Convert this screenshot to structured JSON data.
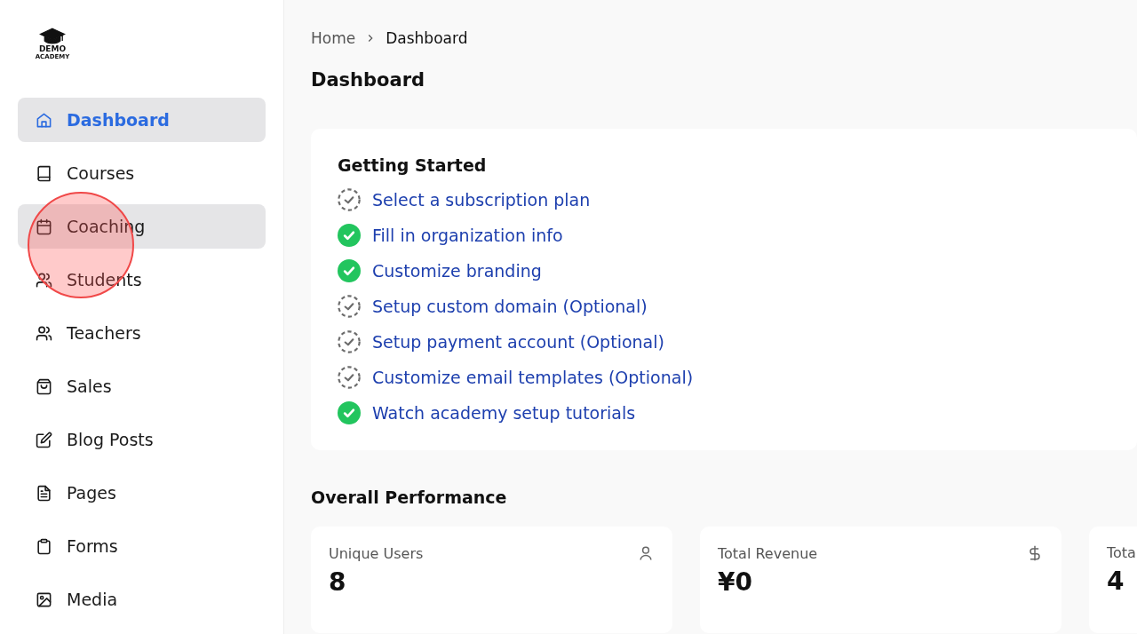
{
  "logo": {
    "line_1": "DEMO",
    "line_2": "ACADEMY"
  },
  "sidebar": {
    "items": [
      {
        "label": "Dashboard",
        "kind": "home",
        "selected": true,
        "hovered": false
      },
      {
        "label": "Courses",
        "kind": "book",
        "selected": false,
        "hovered": false
      },
      {
        "label": "Coaching",
        "kind": "calendar",
        "selected": false,
        "hovered": true
      },
      {
        "label": "Students",
        "kind": "users",
        "selected": false,
        "hovered": false
      },
      {
        "label": "Teachers",
        "kind": "users",
        "selected": false,
        "hovered": false
      },
      {
        "label": "Sales",
        "kind": "bag",
        "selected": false,
        "hovered": false
      },
      {
        "label": "Blog Posts",
        "kind": "edit",
        "selected": false,
        "hovered": false
      },
      {
        "label": "Pages",
        "kind": "file",
        "selected": false,
        "hovered": false
      },
      {
        "label": "Forms",
        "kind": "clipboard",
        "selected": false,
        "hovered": false
      },
      {
        "label": "Media",
        "kind": "image",
        "selected": false,
        "hovered": false
      }
    ]
  },
  "click_marker": {
    "on": true
  },
  "breadcrumb": [
    "Home",
    "Dashboard"
  ],
  "page_title": "Dashboard",
  "getting_started": {
    "title": "Getting Started",
    "steps": [
      {
        "label": "Select a subscription plan",
        "done": false
      },
      {
        "label": "Fill in organization info",
        "done": true
      },
      {
        "label": "Customize branding",
        "done": true
      },
      {
        "label": "Setup custom domain (Optional)",
        "done": false
      },
      {
        "label": "Setup payment account (Optional)",
        "done": false
      },
      {
        "label": "Customize email templates (Optional)",
        "done": false
      },
      {
        "label": "Watch academy setup tutorials",
        "done": true
      }
    ]
  },
  "performance": {
    "title": "Overall Performance",
    "stats": [
      {
        "label": "Unique Users",
        "value": "8",
        "kind": "user"
      },
      {
        "label": "Total Revenue",
        "value": "¥0",
        "kind": "dollar"
      },
      {
        "label": "Tota",
        "value": "4",
        "kind": "none"
      }
    ]
  }
}
